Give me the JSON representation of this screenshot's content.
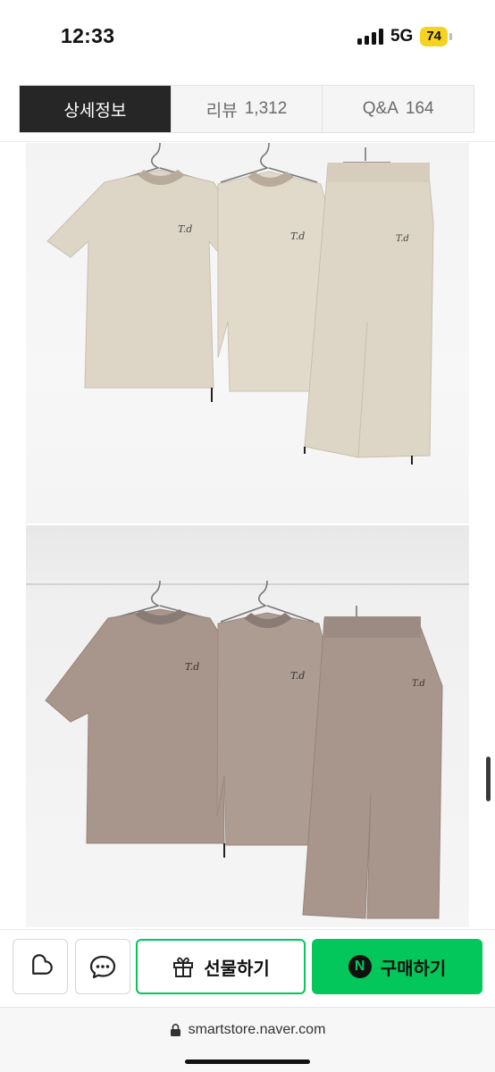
{
  "status_bar": {
    "time": "12:33",
    "network": "5G",
    "battery": "74",
    "battery_color": "#f5d31f"
  },
  "tabs": [
    {
      "label": "상세정보",
      "count": "",
      "active": true
    },
    {
      "label": "리뷰",
      "count": "1,312",
      "active": false
    },
    {
      "label": "Q&A",
      "count": "164",
      "active": false
    }
  ],
  "product_photos": [
    {
      "set_color": "beige",
      "garment_fill": "#ddd5c6",
      "collar_fill": "#b8ab9c"
    },
    {
      "set_color": "taupe",
      "garment_fill": "#a8968d",
      "collar_fill": "#8a7b74"
    }
  ],
  "actions": {
    "wish_icon": "heart-icon",
    "talk_icon": "chat-bubble-icon",
    "gift_label": "선물하기",
    "gift_icon": "gift-icon",
    "buy_label": "구매하기",
    "buy_badge": "N",
    "brand_color": "#03c75a"
  },
  "browser": {
    "url": "smartstore.naver.com",
    "lock_icon": "lock-icon"
  }
}
